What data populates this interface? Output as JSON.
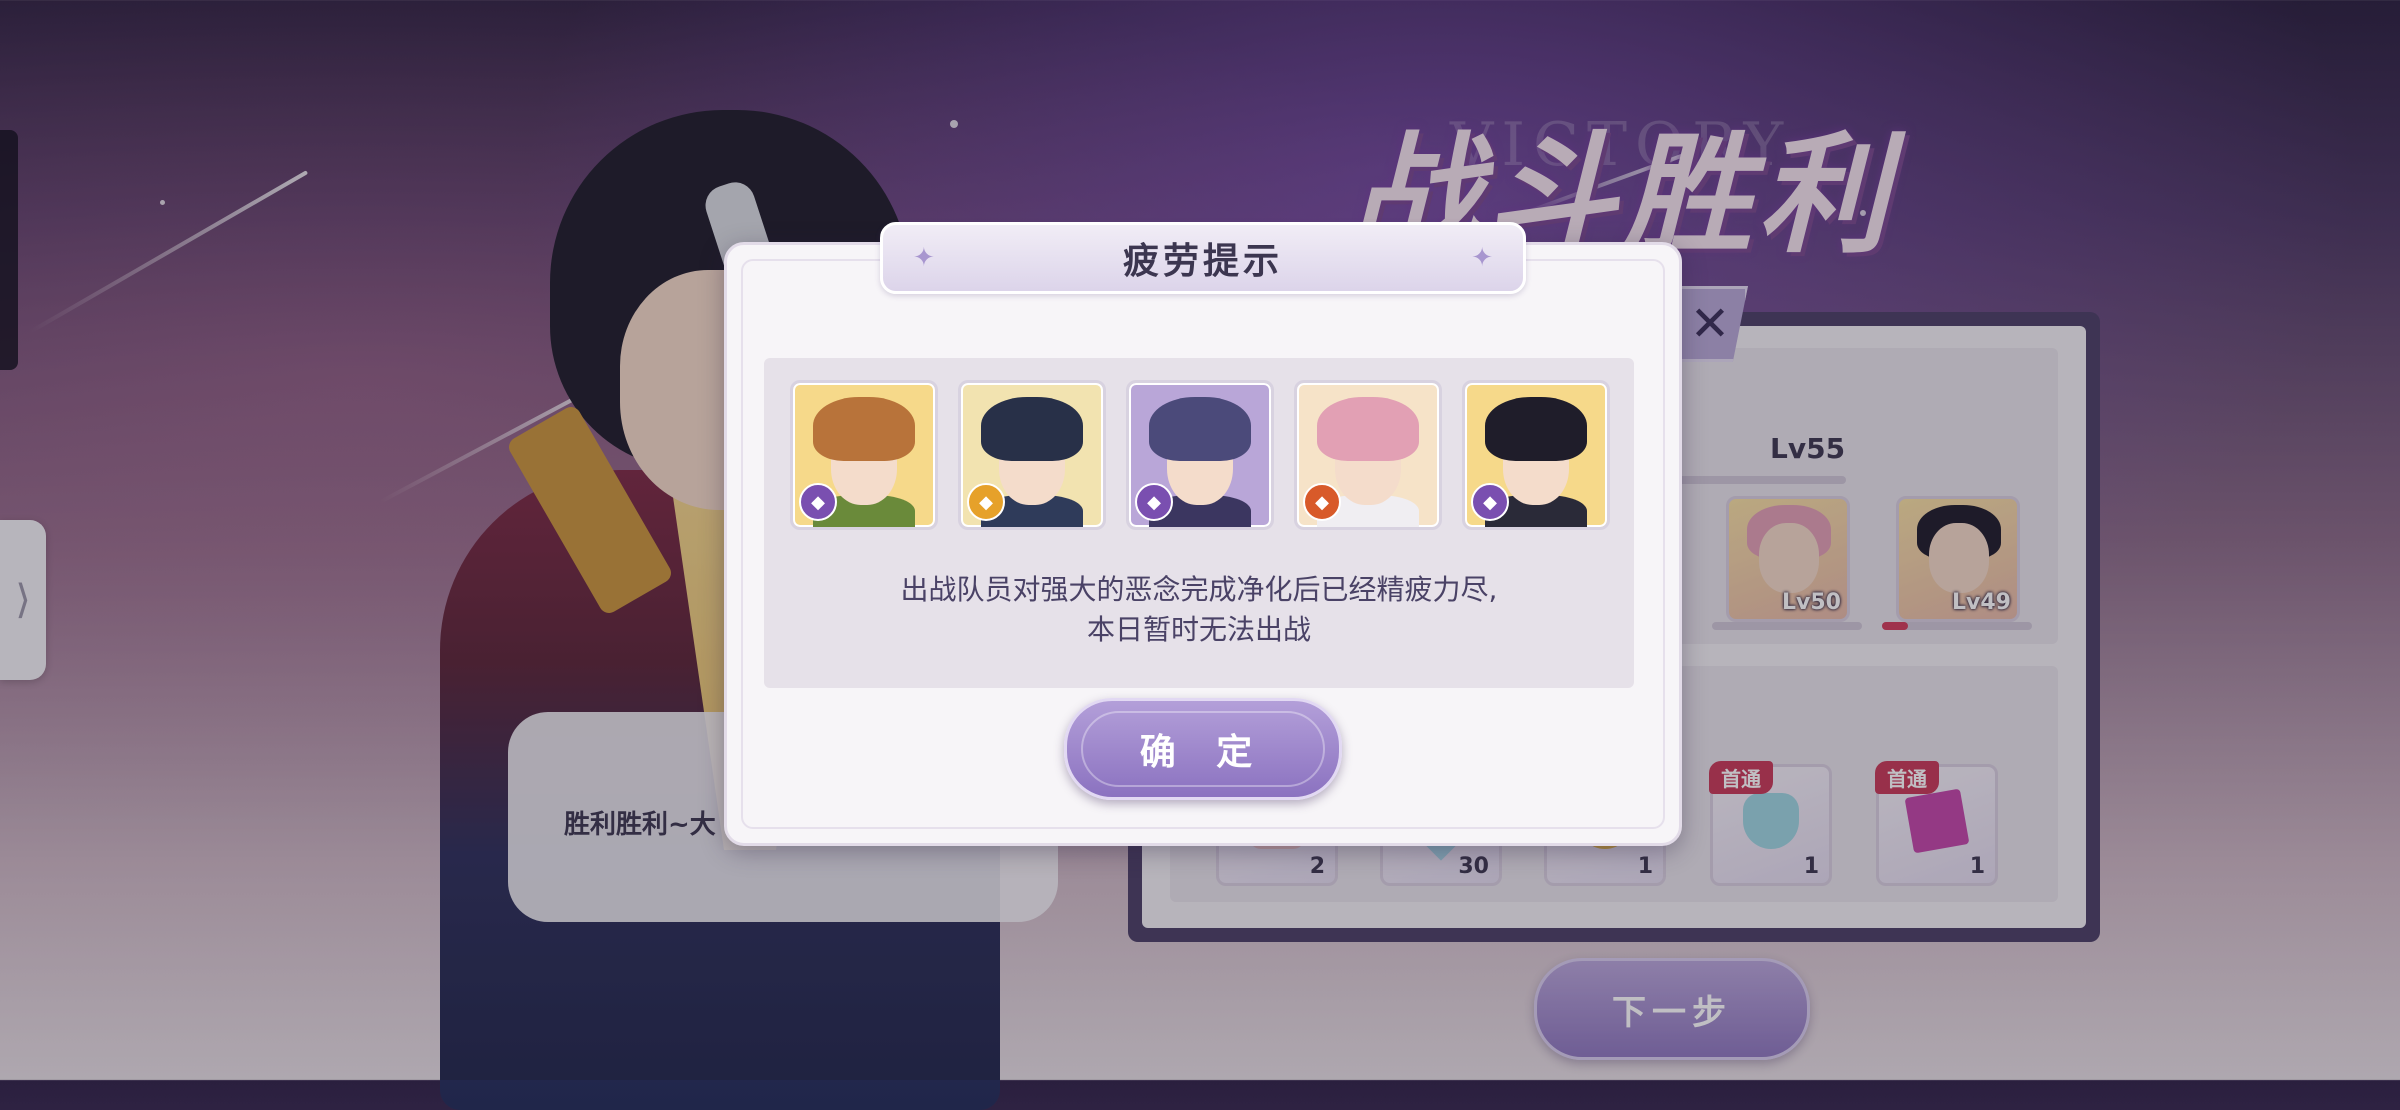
{
  "background": {
    "victory_title": "战斗胜利",
    "victory_subtitle": "VICTORY",
    "speech_text": "胜利胜利~大",
    "result_panel": {
      "main_level": "Lv55",
      "team": [
        {
          "level": "Lv50",
          "hp_fraction": 0.0
        },
        {
          "level": "Lv49",
          "hp_fraction": 0.17
        }
      ],
      "rewards": [
        {
          "qty": "2",
          "first_clear": ""
        },
        {
          "qty": "30",
          "first_clear": ""
        },
        {
          "qty": "1",
          "first_clear": ""
        },
        {
          "qty": "1",
          "first_clear": "首通"
        },
        {
          "qty": "1",
          "first_clear": "首通"
        }
      ],
      "next_button": "下一步"
    },
    "close_icon": "close-icon",
    "side_handle_icon": "chevron-right-icon"
  },
  "modal": {
    "title": "疲劳提示",
    "message_line1": "出战队员对强大的恶念完成净化后已经精疲力尽,",
    "message_line2": "本日暂时无法出战",
    "confirm_label": "确 定",
    "characters": [
      {
        "badge_color": "#7a4fb0",
        "hair": "#b8733a",
        "bg": "#f6d98a",
        "body": "#6a8a3a"
      },
      {
        "badge_color": "#e6a12a",
        "hair": "#283048",
        "bg": "#f2e3b0",
        "body": "#2f3b5a"
      },
      {
        "badge_color": "#7a4fb0",
        "hair": "#4b4a7a",
        "bg": "#b9a6d8",
        "body": "#3b3660"
      },
      {
        "badge_color": "#d85a2a",
        "hair": "#e2a0b4",
        "bg": "#f6e3c8",
        "body": "#f0eef2"
      },
      {
        "badge_color": "#7a4fb0",
        "hair": "#1f1d2a",
        "bg": "#f6d98a",
        "body": "#2a2a38"
      }
    ]
  }
}
